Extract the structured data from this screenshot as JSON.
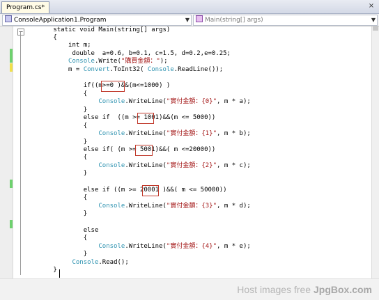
{
  "tabs": [
    {
      "label": "Program.cs*"
    }
  ],
  "tab_close_label": "×",
  "nav": {
    "class_selector": "ConsoleApplication1.Program",
    "member_selector": "Main(string[] args)"
  },
  "code": {
    "lines": [
      {
        "parts": [
          {
            "t": "        static void Main(string[] args)",
            "c": "kw"
          }
        ]
      },
      {
        "parts": [
          {
            "t": "        {",
            "c": "kw"
          }
        ]
      },
      {
        "parts": [
          {
            "t": "            int m;",
            "c": "kw"
          }
        ]
      },
      {
        "parts": [
          {
            "t": "             double  a=0.6, b=0.1, c=1.5, d=0.2,e=0.25;",
            "c": "kw"
          }
        ]
      },
      {
        "parts": [
          {
            "t": "            ",
            "c": "kw"
          },
          {
            "t": "Console",
            "c": "ty"
          },
          {
            "t": ".Write(",
            "c": "kw"
          },
          {
            "t": "\"購買金額：\"",
            "c": "str"
          },
          {
            "t": ");",
            "c": "kw"
          }
        ]
      },
      {
        "parts": [
          {
            "t": "            m = ",
            "c": "kw"
          },
          {
            "t": "Convert",
            "c": "ty"
          },
          {
            "t": ".ToInt32( ",
            "c": "kw"
          },
          {
            "t": "Console",
            "c": "ty"
          },
          {
            "t": ".ReadLine());",
            "c": "kw"
          }
        ]
      },
      {
        "parts": [
          {
            "t": "",
            "c": "kw"
          }
        ]
      },
      {
        "parts": [
          {
            "t": "                if((m>=0 )&&(m<=1000) )",
            "c": "kw"
          }
        ]
      },
      {
        "parts": [
          {
            "t": "                {",
            "c": "kw"
          }
        ]
      },
      {
        "parts": [
          {
            "t": "                    ",
            "c": "kw"
          },
          {
            "t": "Console",
            "c": "ty"
          },
          {
            "t": ".WriteLine(",
            "c": "kw"
          },
          {
            "t": "\"實付金額：{0}\"",
            "c": "str"
          },
          {
            "t": ", m * a);",
            "c": "kw"
          }
        ]
      },
      {
        "parts": [
          {
            "t": "                }",
            "c": "kw"
          }
        ]
      },
      {
        "parts": [
          {
            "t": "                else if  ((m >= 1001)&&(m <= 5000))",
            "c": "kw"
          }
        ]
      },
      {
        "parts": [
          {
            "t": "                {",
            "c": "kw"
          }
        ]
      },
      {
        "parts": [
          {
            "t": "                    ",
            "c": "kw"
          },
          {
            "t": "Console",
            "c": "ty"
          },
          {
            "t": ".WriteLine(",
            "c": "kw"
          },
          {
            "t": "\"實付金額：{1}\"",
            "c": "str"
          },
          {
            "t": ", m * b);",
            "c": "kw"
          }
        ]
      },
      {
        "parts": [
          {
            "t": "                }",
            "c": "kw"
          }
        ]
      },
      {
        "parts": [
          {
            "t": "                else if( (m >= 5001)&&( m <=20000))",
            "c": "kw"
          }
        ]
      },
      {
        "parts": [
          {
            "t": "                {",
            "c": "kw"
          }
        ]
      },
      {
        "parts": [
          {
            "t": "                    ",
            "c": "kw"
          },
          {
            "t": "Console",
            "c": "ty"
          },
          {
            "t": ".WriteLine(",
            "c": "kw"
          },
          {
            "t": "\"實付金額：{2}\"",
            "c": "str"
          },
          {
            "t": ", m * c);",
            "c": "kw"
          }
        ]
      },
      {
        "parts": [
          {
            "t": "                }",
            "c": "kw"
          }
        ]
      },
      {
        "parts": [
          {
            "t": "",
            "c": "kw"
          }
        ]
      },
      {
        "parts": [
          {
            "t": "                else if ((m >= 20001 )&&( m <= 50000))",
            "c": "kw"
          }
        ]
      },
      {
        "parts": [
          {
            "t": "                {",
            "c": "kw"
          }
        ]
      },
      {
        "parts": [
          {
            "t": "                    ",
            "c": "kw"
          },
          {
            "t": "Console",
            "c": "ty"
          },
          {
            "t": ".WriteLine(",
            "c": "kw"
          },
          {
            "t": "\"實付金額：{3}\"",
            "c": "str"
          },
          {
            "t": ", m * d);",
            "c": "kw"
          }
        ]
      },
      {
        "parts": [
          {
            "t": "                }",
            "c": "kw"
          }
        ]
      },
      {
        "parts": [
          {
            "t": "",
            "c": "kw"
          }
        ]
      },
      {
        "parts": [
          {
            "t": "                else",
            "c": "kw"
          }
        ]
      },
      {
        "parts": [
          {
            "t": "                {",
            "c": "kw"
          }
        ]
      },
      {
        "parts": [
          {
            "t": "                    ",
            "c": "kw"
          },
          {
            "t": "Console",
            "c": "ty"
          },
          {
            "t": ".WriteLine(",
            "c": "kw"
          },
          {
            "t": "\"實付金額：{4}\"",
            "c": "str"
          },
          {
            "t": ", m * e);",
            "c": "kw"
          }
        ]
      },
      {
        "parts": [
          {
            "t": "                }",
            "c": "kw"
          }
        ]
      },
      {
        "parts": [
          {
            "t": "             ",
            "c": "kw"
          },
          {
            "t": "Console",
            "c": "ty"
          },
          {
            "t": ".Read();",
            "c": "kw"
          }
        ]
      },
      {
        "parts": [
          {
            "t": "        }",
            "c": "kw"
          }
        ]
      }
    ]
  },
  "watermark": {
    "prefix": "Host images free ",
    "brand": "JpgBox.com"
  }
}
